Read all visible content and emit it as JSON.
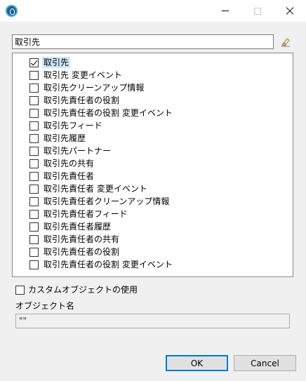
{
  "window": {
    "title": "",
    "app_icon": "talend-app-icon"
  },
  "filter": {
    "value": "取引先",
    "clear_icon": "eraser-icon"
  },
  "items": [
    {
      "label": "取引先",
      "checked": true,
      "selected": true
    },
    {
      "label": "取引先 変更イベント",
      "checked": false
    },
    {
      "label": "取引先クリーンアップ情報",
      "checked": false
    },
    {
      "label": "取引先責任者の役割",
      "checked": false
    },
    {
      "label": "取引先責任者の役割 変更イベント",
      "checked": false
    },
    {
      "label": "取引先フィード",
      "checked": false
    },
    {
      "label": "取引先履歴",
      "checked": false
    },
    {
      "label": "取引先パートナー",
      "checked": false
    },
    {
      "label": "取引先の共有",
      "checked": false
    },
    {
      "label": "取引先責任者",
      "checked": false
    },
    {
      "label": "取引先責任者 変更イベント",
      "checked": false
    },
    {
      "label": "取引先責任者クリーンアップ情報",
      "checked": false
    },
    {
      "label": "取引先責任者フィード",
      "checked": false
    },
    {
      "label": "取引先責任者履歴",
      "checked": false
    },
    {
      "label": "取引先責任者の共有",
      "checked": false
    },
    {
      "label": "取引先責任者の役割",
      "checked": false
    },
    {
      "label": "取引先責任者の役割 変更イベント",
      "checked": false
    }
  ],
  "custom_object": {
    "label": "カスタムオブジェクトの使用",
    "checked": false
  },
  "object_name": {
    "label": "オブジェクト名",
    "value": "\"\""
  },
  "buttons": {
    "ok": "OK",
    "cancel": "Cancel"
  },
  "colors": {
    "accent": "#0078d7",
    "selection": "#cce8ff"
  }
}
